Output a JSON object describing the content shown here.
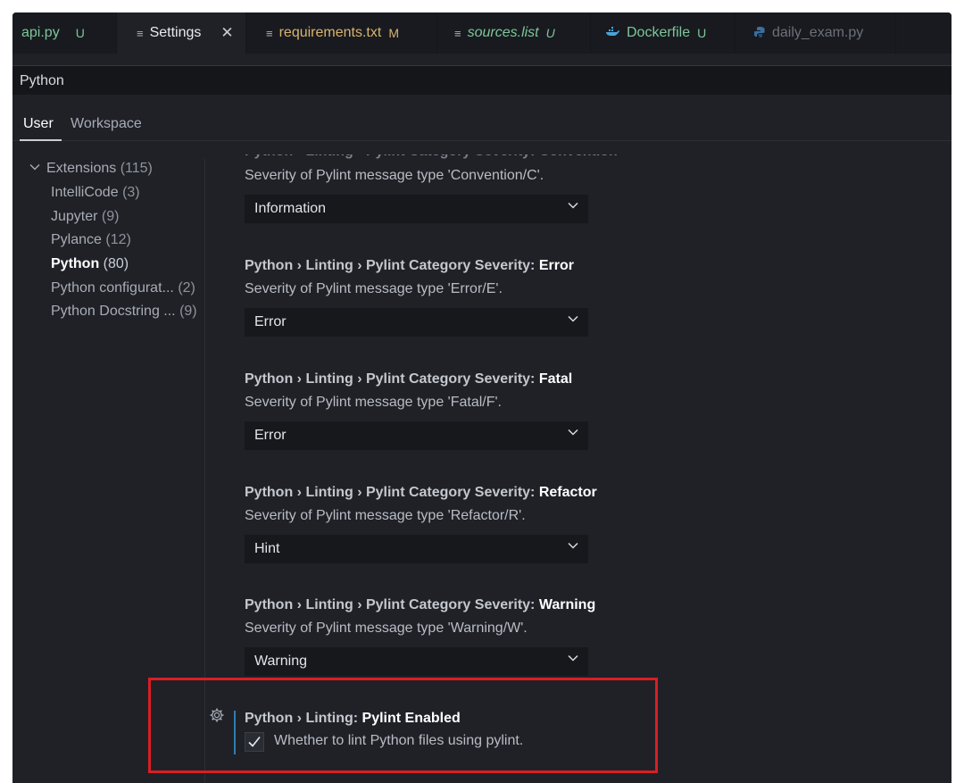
{
  "tabs": [
    {
      "label": "api.py",
      "badge": "U",
      "icon": "python-file-icon",
      "color": "#7ec699",
      "badge_color": "#7ec699"
    },
    {
      "label": "Settings",
      "badge": "",
      "icon": "settings-file-icon",
      "color": "#e8eaee",
      "close": "✕"
    },
    {
      "label": "requirements.txt",
      "badge": "M",
      "icon": "text-file-icon",
      "color": "#d9b36c",
      "badge_color": "#d9b36c"
    },
    {
      "label": "sources.list",
      "badge": "U",
      "icon": "text-file-icon",
      "color": "#7ec699",
      "badge_color": "#7ec699",
      "italic": true
    },
    {
      "label": "Dockerfile",
      "badge": "U",
      "icon": "docker-icon",
      "color": "#7ec699",
      "badge_color": "#7ec699"
    },
    {
      "label": "daily_exam.py",
      "badge": "",
      "icon": "python-file-icon",
      "color": "#6c707a"
    }
  ],
  "search": {
    "value": "Python"
  },
  "scope_tabs": [
    {
      "label": "User",
      "active": true
    },
    {
      "label": "Workspace",
      "active": false
    }
  ],
  "toc": [
    {
      "label": "Extensions",
      "count": "(115)",
      "expanded": true
    },
    {
      "label": "IntelliCode",
      "count": "(3)"
    },
    {
      "label": "Jupyter",
      "count": "(9)"
    },
    {
      "label": "Pylance",
      "count": "(12)"
    },
    {
      "label": "Python",
      "count": "(80)",
      "selected": true
    },
    {
      "label": "Python configurat...",
      "count": "(2)"
    },
    {
      "label": "Python Docstring ...",
      "count": "(9)"
    }
  ],
  "partial_setting": {
    "title_prefix": "Python › Linting › Pylint Category Severity: ",
    "title_key": "Convention",
    "description": "Severity of Pylint message type 'Convention/C'.",
    "value": "Information"
  },
  "settings": [
    {
      "prefix": "Python › Linting › Pylint Category Severity: ",
      "key": "Error",
      "description": "Severity of Pylint message type 'Error/E'.",
      "value": "Error"
    },
    {
      "prefix": "Python › Linting › Pylint Category Severity: ",
      "key": "Fatal",
      "description": "Severity of Pylint message type 'Fatal/F'.",
      "value": "Error"
    },
    {
      "prefix": "Python › Linting › Pylint Category Severity: ",
      "key": "Refactor",
      "description": "Severity of Pylint message type 'Refactor/R'.",
      "value": "Hint"
    },
    {
      "prefix": "Python › Linting › Pylint Category Severity: ",
      "key": "Warning",
      "description": "Severity of Pylint message type 'Warning/W'.",
      "value": "Warning"
    }
  ],
  "pylint_enabled": {
    "prefix": "Python › Linting: ",
    "key": "Pylint Enabled",
    "description": "Whether to lint Python files using pylint.",
    "checked": true
  },
  "colors": {
    "highlight": "#d91e24",
    "accent": "#2f7fae",
    "background": "#1f2127"
  }
}
